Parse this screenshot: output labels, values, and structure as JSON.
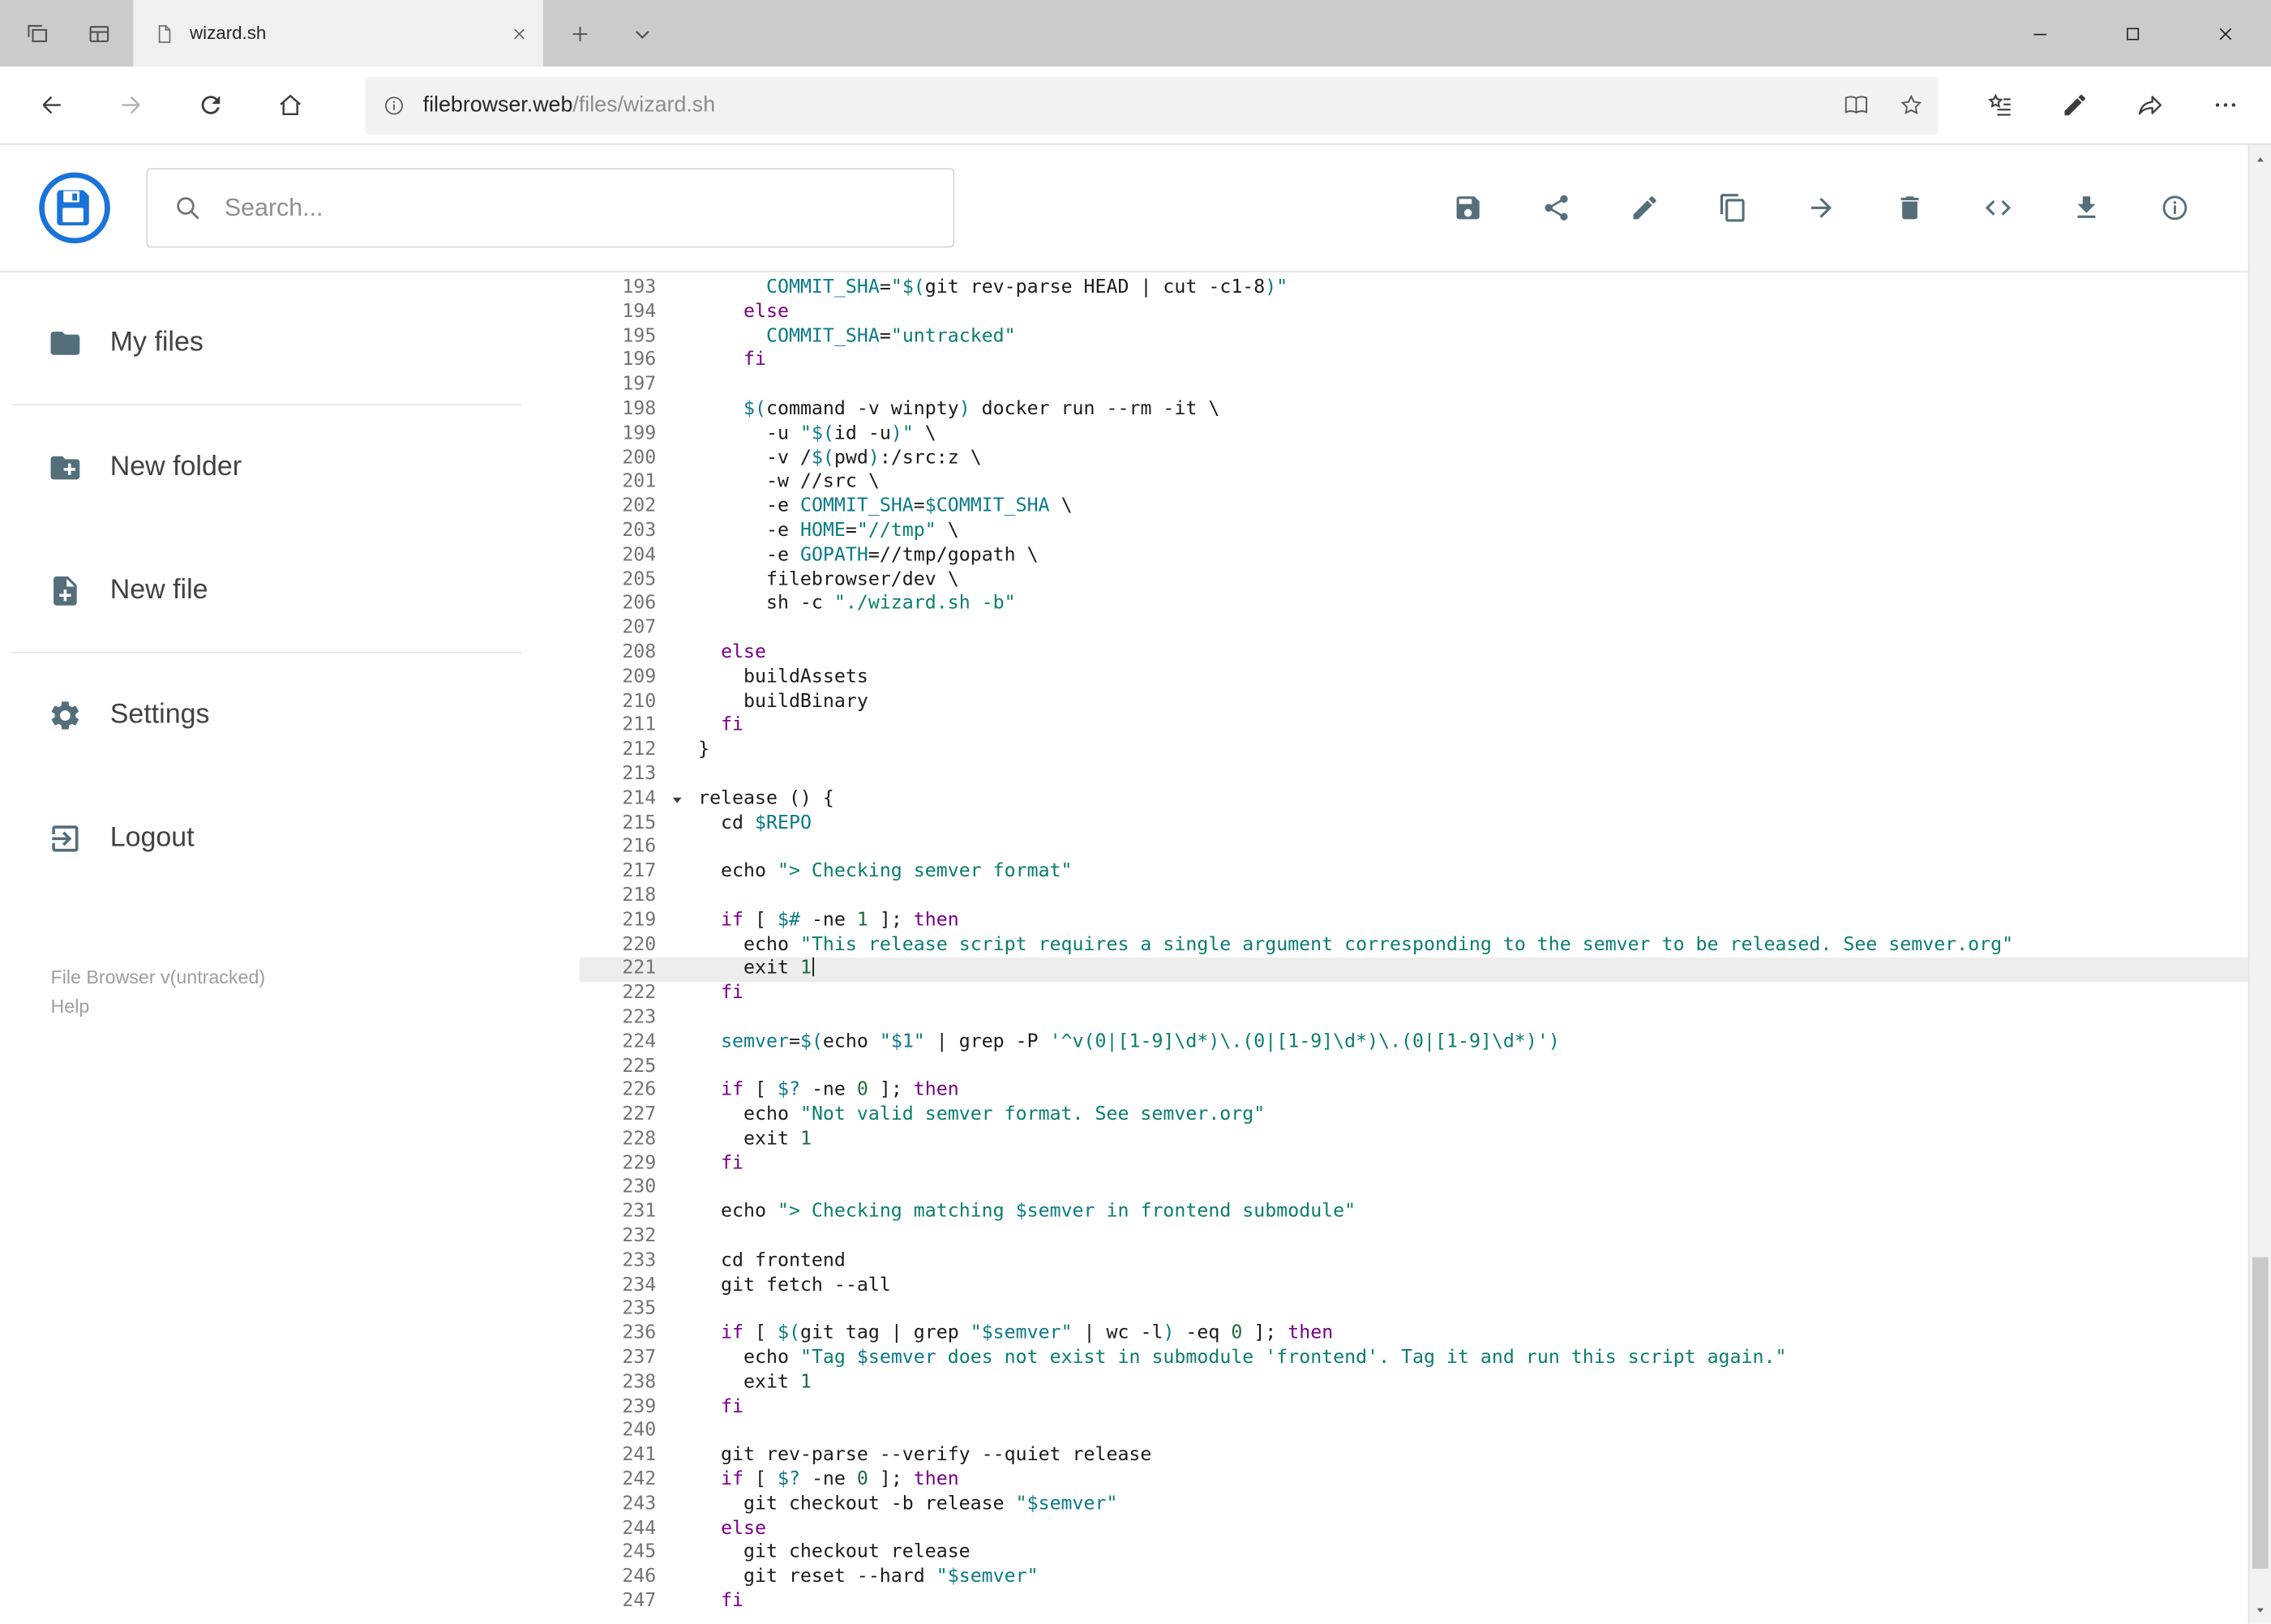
{
  "browser": {
    "tab_title": "wizard.sh",
    "url_host": "filebrowser.web",
    "url_path": "/files/wizard.sh",
    "tab_strip_buttons": [
      {
        "name": "set-tabs-aside-button",
        "icon": "tabs-stack-icon"
      },
      {
        "name": "tab-preview-button",
        "icon": "window-panes-icon"
      }
    ],
    "tab_actions": [
      {
        "name": "new-tab-button",
        "icon": "plus-icon"
      },
      {
        "name": "tab-preview-toggle",
        "icon": "chevron-down-icon"
      }
    ],
    "window_controls": [
      {
        "name": "minimize-button",
        "icon": "minimize-icon"
      },
      {
        "name": "maximize-button",
        "icon": "maximize-icon"
      },
      {
        "name": "close-button",
        "icon": "close-icon"
      }
    ],
    "nav_buttons": [
      {
        "name": "back-button",
        "icon": "arrow-left-icon"
      },
      {
        "name": "forward-button",
        "icon": "arrow-right-icon",
        "disabled": true
      },
      {
        "name": "refresh-button",
        "icon": "refresh-icon"
      },
      {
        "name": "home-button",
        "icon": "home-icon"
      }
    ],
    "address_bar_buttons": [
      {
        "name": "reading-view-button",
        "icon": "book-icon"
      },
      {
        "name": "add-favorite-button",
        "icon": "star-icon"
      }
    ],
    "toolbar_buttons": [
      {
        "name": "hub-button",
        "icon": "hub-icon"
      },
      {
        "name": "web-note-button",
        "icon": "pen-icon"
      },
      {
        "name": "share-page-button",
        "icon": "share-forward-icon"
      },
      {
        "name": "more-button",
        "icon": "more-icon"
      }
    ]
  },
  "header": {
    "search_placeholder": "Search...",
    "actions": [
      {
        "name": "save-button",
        "icon": "floppy-icon"
      },
      {
        "name": "share-file-button",
        "icon": "share-icon"
      },
      {
        "name": "rename-button",
        "icon": "pencil-icon"
      },
      {
        "name": "copy-button",
        "icon": "copy-icon"
      },
      {
        "name": "move-button",
        "icon": "arrow-forward-icon"
      },
      {
        "name": "delete-button",
        "icon": "trash-icon"
      },
      {
        "name": "code-view-button",
        "icon": "code-icon"
      },
      {
        "name": "download-button",
        "icon": "download-icon"
      },
      {
        "name": "info-button",
        "icon": "info-icon"
      }
    ]
  },
  "sidebar": {
    "items": [
      {
        "label": "My files",
        "icon": "folder-icon",
        "name": "sidebar-item-my-files"
      },
      {
        "type": "divider"
      },
      {
        "label": "New folder",
        "icon": "folder-plus-icon",
        "name": "sidebar-item-new-folder"
      },
      {
        "label": "New file",
        "icon": "file-plus-icon",
        "name": "sidebar-item-new-file"
      },
      {
        "type": "divider"
      },
      {
        "label": "Settings",
        "icon": "gear-icon",
        "name": "sidebar-item-settings"
      },
      {
        "label": "Logout",
        "icon": "logout-icon",
        "name": "sidebar-item-logout"
      }
    ],
    "footer_version": "File Browser v(untracked)",
    "footer_help": "Help"
  },
  "colors": {
    "accent_blue": "#1a73d9",
    "icon_gray": "#546e7a",
    "tabbar_gray": "#cbcbcb",
    "syntax_keyword": "#770088",
    "syntax_string": "#0b7d6e",
    "syntax_variable": "#0b7a8a",
    "syntax_number": "#1d6a3c",
    "line_number_gray": "#737373",
    "active_line_bg": "#ededed"
  },
  "editor": {
    "active_line": 221,
    "cursor_line": 221,
    "fold_marker_line": 214,
    "lines": [
      {
        "n": 193,
        "t": [
          [
            "p",
            "      "
          ],
          [
            "v",
            "COMMIT_SHA"
          ],
          [
            "p",
            "="
          ],
          [
            "s",
            "\""
          ],
          [
            "v",
            "$("
          ],
          [
            "p",
            "git rev-parse HEAD | cut -c1-8"
          ],
          [
            "v",
            ")"
          ],
          [
            "s",
            "\""
          ]
        ]
      },
      {
        "n": 194,
        "t": [
          [
            "p",
            "    "
          ],
          [
            "k",
            "else"
          ]
        ]
      },
      {
        "n": 195,
        "t": [
          [
            "p",
            "      "
          ],
          [
            "v",
            "COMMIT_SHA"
          ],
          [
            "p",
            "="
          ],
          [
            "s",
            "\"untracked\""
          ]
        ]
      },
      {
        "n": 196,
        "t": [
          [
            "p",
            "    "
          ],
          [
            "k",
            "fi"
          ]
        ]
      },
      {
        "n": 197,
        "t": []
      },
      {
        "n": 198,
        "t": [
          [
            "p",
            "    "
          ],
          [
            "v",
            "$("
          ],
          [
            "p",
            "command -v winpty"
          ],
          [
            "v",
            ")"
          ],
          [
            "p",
            " docker run --rm -it \\"
          ]
        ]
      },
      {
        "n": 199,
        "t": [
          [
            "p",
            "      -u "
          ],
          [
            "s",
            "\""
          ],
          [
            "v",
            "$("
          ],
          [
            "p",
            "id -u"
          ],
          [
            "v",
            ")"
          ],
          [
            "s",
            "\""
          ],
          [
            "p",
            " \\"
          ]
        ]
      },
      {
        "n": 200,
        "t": [
          [
            "p",
            "      -v /"
          ],
          [
            "v",
            "$("
          ],
          [
            "p",
            "pwd"
          ],
          [
            "v",
            ")"
          ],
          [
            "p",
            ":/src:z \\"
          ]
        ]
      },
      {
        "n": 201,
        "t": [
          [
            "p",
            "      -w //src \\"
          ]
        ]
      },
      {
        "n": 202,
        "t": [
          [
            "p",
            "      -e "
          ],
          [
            "v",
            "COMMIT_SHA"
          ],
          [
            "p",
            "="
          ],
          [
            "v",
            "$COMMIT_SHA"
          ],
          [
            "p",
            " \\"
          ]
        ]
      },
      {
        "n": 203,
        "t": [
          [
            "p",
            "      -e "
          ],
          [
            "v",
            "HOME"
          ],
          [
            "p",
            "="
          ],
          [
            "s",
            "\"//tmp\""
          ],
          [
            "p",
            " \\"
          ]
        ]
      },
      {
        "n": 204,
        "t": [
          [
            "p",
            "      -e "
          ],
          [
            "v",
            "GOPATH"
          ],
          [
            "p",
            "=//tmp/gopath \\"
          ]
        ]
      },
      {
        "n": 205,
        "t": [
          [
            "p",
            "      filebrowser/dev \\"
          ]
        ]
      },
      {
        "n": 206,
        "t": [
          [
            "p",
            "      sh -c "
          ],
          [
            "s",
            "\"./wizard.sh -b\""
          ]
        ]
      },
      {
        "n": 207,
        "t": []
      },
      {
        "n": 208,
        "t": [
          [
            "p",
            "  "
          ],
          [
            "k",
            "else"
          ]
        ]
      },
      {
        "n": 209,
        "t": [
          [
            "p",
            "    buildAssets"
          ]
        ]
      },
      {
        "n": 210,
        "t": [
          [
            "p",
            "    buildBinary"
          ]
        ]
      },
      {
        "n": 211,
        "t": [
          [
            "p",
            "  "
          ],
          [
            "k",
            "fi"
          ]
        ]
      },
      {
        "n": 212,
        "t": [
          [
            "p",
            "}"
          ]
        ]
      },
      {
        "n": 213,
        "t": []
      },
      {
        "n": 214,
        "t": [
          [
            "p",
            "release () {"
          ]
        ]
      },
      {
        "n": 215,
        "t": [
          [
            "p",
            "  cd "
          ],
          [
            "v",
            "$REPO"
          ]
        ]
      },
      {
        "n": 216,
        "t": []
      },
      {
        "n": 217,
        "t": [
          [
            "p",
            "  echo "
          ],
          [
            "s",
            "\"> Checking semver format\""
          ]
        ]
      },
      {
        "n": 218,
        "t": []
      },
      {
        "n": 219,
        "t": [
          [
            "p",
            "  "
          ],
          [
            "k",
            "if"
          ],
          [
            "p",
            " [ "
          ],
          [
            "v",
            "$#"
          ],
          [
            "p",
            " -ne "
          ],
          [
            "d",
            "1"
          ],
          [
            "p",
            " ]; "
          ],
          [
            "k",
            "then"
          ]
        ]
      },
      {
        "n": 220,
        "t": [
          [
            "p",
            "    echo "
          ],
          [
            "s",
            "\"This release script requires a single argument corresponding to the semver to be released. See semver.org\""
          ]
        ]
      },
      {
        "n": 221,
        "t": [
          [
            "p",
            "    exit "
          ],
          [
            "d",
            "1"
          ]
        ]
      },
      {
        "n": 222,
        "t": [
          [
            "p",
            "  "
          ],
          [
            "k",
            "fi"
          ]
        ]
      },
      {
        "n": 223,
        "t": []
      },
      {
        "n": 224,
        "t": [
          [
            "p",
            "  "
          ],
          [
            "v",
            "semver"
          ],
          [
            "p",
            "="
          ],
          [
            "v",
            "$("
          ],
          [
            "p",
            "echo "
          ],
          [
            "s",
            "\""
          ],
          [
            "v",
            "$1"
          ],
          [
            "s",
            "\""
          ],
          [
            "p",
            " | grep -P "
          ],
          [
            "s",
            "'^v(0|[1-9]\\d*)\\.(0|[1-9]\\d*)\\.(0|[1-9]\\d*)'"
          ],
          [
            "v",
            ")"
          ]
        ]
      },
      {
        "n": 225,
        "t": []
      },
      {
        "n": 226,
        "t": [
          [
            "p",
            "  "
          ],
          [
            "k",
            "if"
          ],
          [
            "p",
            " [ "
          ],
          [
            "v",
            "$?"
          ],
          [
            "p",
            " -ne "
          ],
          [
            "d",
            "0"
          ],
          [
            "p",
            " ]; "
          ],
          [
            "k",
            "then"
          ]
        ]
      },
      {
        "n": 227,
        "t": [
          [
            "p",
            "    echo "
          ],
          [
            "s",
            "\"Not valid semver format. See semver.org\""
          ]
        ]
      },
      {
        "n": 228,
        "t": [
          [
            "p",
            "    exit "
          ],
          [
            "d",
            "1"
          ]
        ]
      },
      {
        "n": 229,
        "t": [
          [
            "p",
            "  "
          ],
          [
            "k",
            "fi"
          ]
        ]
      },
      {
        "n": 230,
        "t": []
      },
      {
        "n": 231,
        "t": [
          [
            "p",
            "  echo "
          ],
          [
            "s",
            "\"> Checking matching "
          ],
          [
            "v",
            "$semver"
          ],
          [
            "s",
            " in frontend submodule\""
          ]
        ]
      },
      {
        "n": 232,
        "t": []
      },
      {
        "n": 233,
        "t": [
          [
            "p",
            "  cd frontend"
          ]
        ]
      },
      {
        "n": 234,
        "t": [
          [
            "p",
            "  git fetch --all"
          ]
        ]
      },
      {
        "n": 235,
        "t": []
      },
      {
        "n": 236,
        "t": [
          [
            "p",
            "  "
          ],
          [
            "k",
            "if"
          ],
          [
            "p",
            " [ "
          ],
          [
            "v",
            "$("
          ],
          [
            "p",
            "git tag | grep "
          ],
          [
            "s",
            "\""
          ],
          [
            "v",
            "$semver"
          ],
          [
            "s",
            "\""
          ],
          [
            "p",
            " | wc -l"
          ],
          [
            "v",
            ")"
          ],
          [
            "p",
            " -eq "
          ],
          [
            "d",
            "0"
          ],
          [
            "p",
            " ]; "
          ],
          [
            "k",
            "then"
          ]
        ]
      },
      {
        "n": 237,
        "t": [
          [
            "p",
            "    echo "
          ],
          [
            "s",
            "\"Tag "
          ],
          [
            "v",
            "$semver"
          ],
          [
            "s",
            " does not exist in submodule 'frontend'. Tag it and run this script again.\""
          ]
        ]
      },
      {
        "n": 238,
        "t": [
          [
            "p",
            "    exit "
          ],
          [
            "d",
            "1"
          ]
        ]
      },
      {
        "n": 239,
        "t": [
          [
            "p",
            "  "
          ],
          [
            "k",
            "fi"
          ]
        ]
      },
      {
        "n": 240,
        "t": []
      },
      {
        "n": 241,
        "t": [
          [
            "p",
            "  git rev-parse --verify --quiet release"
          ]
        ]
      },
      {
        "n": 242,
        "t": [
          [
            "p",
            "  "
          ],
          [
            "k",
            "if"
          ],
          [
            "p",
            " [ "
          ],
          [
            "v",
            "$?"
          ],
          [
            "p",
            " -ne "
          ],
          [
            "d",
            "0"
          ],
          [
            "p",
            " ]; "
          ],
          [
            "k",
            "then"
          ]
        ]
      },
      {
        "n": 243,
        "t": [
          [
            "p",
            "    git checkout -b release "
          ],
          [
            "s",
            "\""
          ],
          [
            "v",
            "$semver"
          ],
          [
            "s",
            "\""
          ]
        ]
      },
      {
        "n": 244,
        "t": [
          [
            "p",
            "  "
          ],
          [
            "k",
            "else"
          ]
        ]
      },
      {
        "n": 245,
        "t": [
          [
            "p",
            "    git checkout release"
          ]
        ]
      },
      {
        "n": 246,
        "t": [
          [
            "p",
            "    git reset --hard "
          ],
          [
            "s",
            "\""
          ],
          [
            "v",
            "$semver"
          ],
          [
            "s",
            "\""
          ]
        ]
      },
      {
        "n": 247,
        "t": [
          [
            "p",
            "  "
          ],
          [
            "k",
            "fi"
          ]
        ]
      }
    ]
  }
}
